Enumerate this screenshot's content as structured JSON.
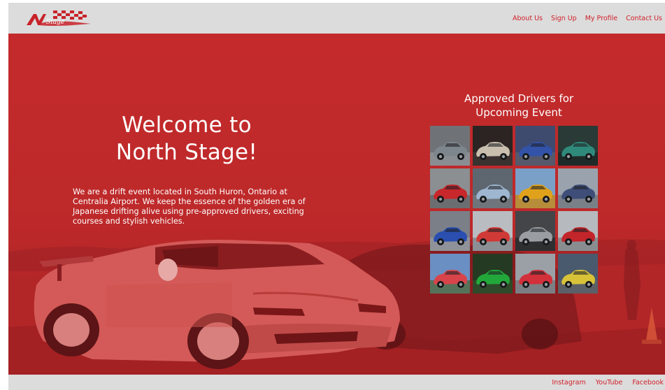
{
  "header": {
    "logo_text": "North Stage",
    "nav": [
      "About Us",
      "Sign Up",
      "My Profile",
      "Contact Us"
    ]
  },
  "hero": {
    "title_line1": "Welcome to",
    "title_line2": "North Stage!",
    "intro": "We are a drift event located in South Huron, Ontario at Centralia Airport. We keep the essence of the golden era of Japanese drifting alive using pre-approved drivers, exciting courses and stylish vehicles."
  },
  "drivers": {
    "title_line1": "Approved Drivers for",
    "title_line2": "Upcoming Event",
    "tiles": [
      {
        "bg": "#6f7377",
        "car": "#7e868d",
        "ground": "#8a8e92"
      },
      {
        "bg": "#2b2423",
        "car": "#c9bfae",
        "ground": "#3a3230"
      },
      {
        "bg": "#3e4a6e",
        "car": "#3253a8",
        "ground": "#55596a"
      },
      {
        "bg": "#2a3a36",
        "car": "#2f8a7c",
        "ground": "#1f2b28"
      },
      {
        "bg": "#8b8f92",
        "car": "#c8272b",
        "ground": "#6b6e70"
      },
      {
        "bg": "#5e6670",
        "car": "#9eb6d0",
        "ground": "#6f757a"
      },
      {
        "bg": "#7aa0c8",
        "car": "#e0a21a",
        "ground": "#b78c3a"
      },
      {
        "bg": "#9aa3ad",
        "car": "#3e4e78",
        "ground": "#7a8087"
      },
      {
        "bg": "#7a7f88",
        "car": "#2a4fb0",
        "ground": "#8f9299"
      },
      {
        "bg": "#b9bcc0",
        "car": "#d03a36",
        "ground": "#8c8f93"
      },
      {
        "bg": "#444548",
        "car": "#9a9ea3",
        "ground": "#2e2f31"
      },
      {
        "bg": "#b6b9bd",
        "car": "#c2252a",
        "ground": "#8a8d90"
      },
      {
        "bg": "#6a8fc2",
        "car": "#d8444a",
        "ground": "#56735a"
      },
      {
        "bg": "#253a22",
        "car": "#22a83a",
        "ground": "#2f4a2a"
      },
      {
        "bg": "#9aa0a6",
        "car": "#d2303a",
        "ground": "#7b7f84"
      },
      {
        "bg": "#4a5a6e",
        "car": "#d8c238",
        "ground": "#5b6068"
      }
    ]
  },
  "footer": {
    "links": [
      "Instagram",
      "YouTube",
      "Facebook"
    ]
  },
  "colors": {
    "brand_red": "#d0202a",
    "hero_red": "#c32a2b",
    "bar_gray": "#dcdcdc"
  }
}
